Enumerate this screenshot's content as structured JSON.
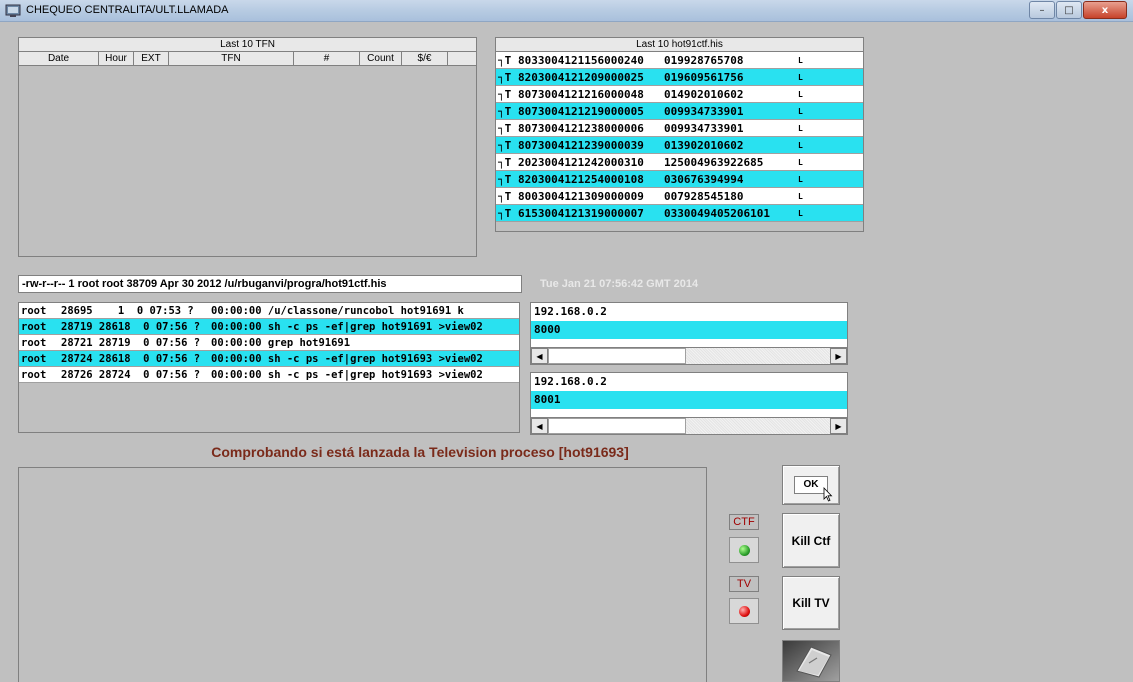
{
  "window": {
    "title": "CHEQUEO CENTRALITA/ULT.LLAMADA",
    "minimize": "–",
    "maximize": "□",
    "close": "x"
  },
  "tfn_grid": {
    "title": "Last 10 TFN",
    "columns": [
      "Date",
      "Hour",
      "EXT",
      "TFN",
      "#",
      "Count",
      "$/€"
    ]
  },
  "his_grid": {
    "title": "Last 10 hot91ctf.his",
    "rows": [
      {
        "prefix": "┐T",
        "id": "8033004121156000240",
        "num": "019928765708",
        "flag": "L",
        "color": "white"
      },
      {
        "prefix": "┐T",
        "id": "8203004121209000025",
        "num": "019609561756",
        "flag": "L",
        "color": "cyan"
      },
      {
        "prefix": "┐T",
        "id": "8073004121216000048",
        "num": "014902010602",
        "flag": "L",
        "color": "white"
      },
      {
        "prefix": "┐T",
        "id": "8073004121219000005",
        "num": "009934733901",
        "flag": "L",
        "color": "cyan"
      },
      {
        "prefix": "┐T",
        "id": "8073004121238000006",
        "num": "009934733901",
        "flag": "L",
        "color": "white"
      },
      {
        "prefix": "┐T",
        "id": "8073004121239000039",
        "num": "013902010602",
        "flag": "L",
        "color": "cyan"
      },
      {
        "prefix": "┐T",
        "id": "2023004121242000310",
        "num": "125004963922685",
        "flag": "L",
        "color": "white"
      },
      {
        "prefix": "┐T",
        "id": "8203004121254000108",
        "num": "030676394994",
        "flag": "L",
        "color": "cyan"
      },
      {
        "prefix": "┐T",
        "id": "8003004121309000009",
        "num": "007928545180",
        "flag": "L",
        "color": "white"
      },
      {
        "prefix": "┐T",
        "id": "6153004121319000007",
        "num": "0330049405206101",
        "flag": "L",
        "color": "cyan"
      }
    ]
  },
  "file_info": "-rw-r--r--  1 root root 38709 Apr 30  2012 /u/rbuganvi/progra/hot91ctf.his",
  "datetime": "Tue Jan 21 07:56:42 GMT 2014",
  "processes": [
    {
      "user": "root",
      "pids": "28695    1  0 07:53 ?",
      "cmd": "00:00:00 /u/classone/runcobol hot91691 k",
      "color": "white"
    },
    {
      "user": "root",
      "pids": "28719 28618  0 07:56 ?",
      "cmd": "00:00:00 sh -c ps -ef|grep hot91691 >view02",
      "color": "cyan"
    },
    {
      "user": "root",
      "pids": "28721 28719  0 07:56 ?",
      "cmd": "00:00:00 grep hot91691",
      "color": "white"
    },
    {
      "user": "root",
      "pids": "28724 28618  0 07:56 ?",
      "cmd": "00:00:00 sh -c ps -ef|grep hot91693 >view02",
      "color": "cyan"
    },
    {
      "user": "root",
      "pids": "28726 28724  0 07:56 ?",
      "cmd": "00:00:00 sh -c ps -ef|grep hot91693 >view02",
      "color": "white"
    }
  ],
  "connection1": {
    "ip": "192.168.0.2",
    "port": "8000"
  },
  "connection2": {
    "ip": "192.168.0.2",
    "port": "8001"
  },
  "status_message": "Comprobando si está lanzada la Television proceso [hot91693]",
  "buttons": {
    "ok": "OK",
    "kill_ctf": "Kill Ctf",
    "kill_tv": "Kill TV"
  },
  "indicators": {
    "ctf_label": "CTF",
    "ctf_state": "green",
    "tv_label": "TV",
    "tv_state": "red"
  },
  "colors": {
    "row_highlight": "#29e1f0",
    "status_message": "#7a2a1a"
  }
}
